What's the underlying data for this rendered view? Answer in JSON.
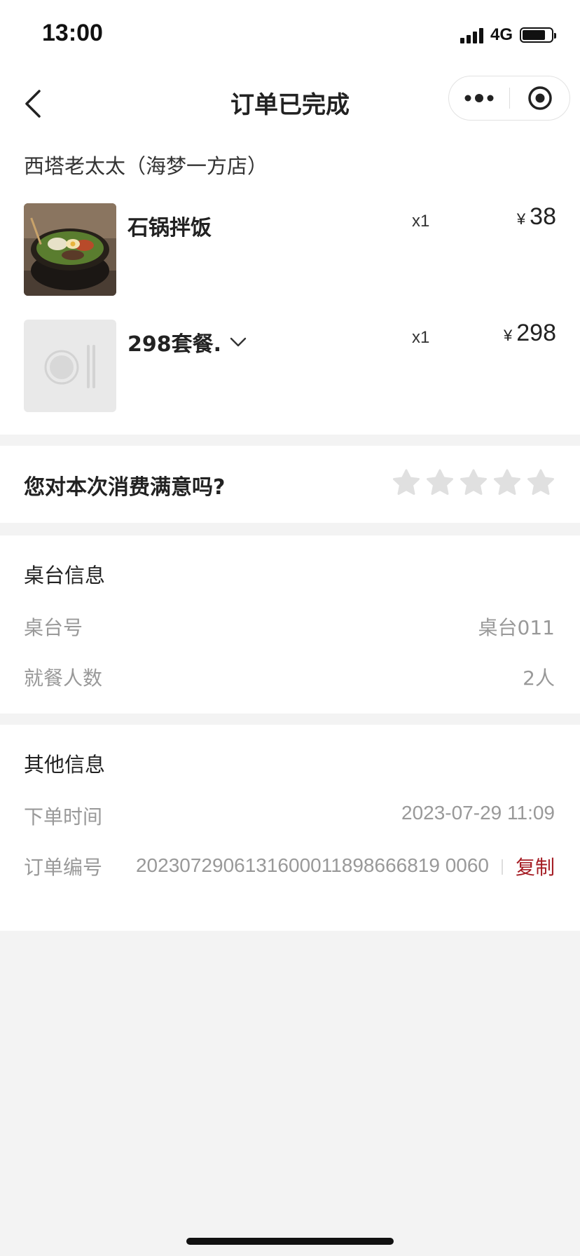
{
  "status": {
    "time": "13:00",
    "network": "4G"
  },
  "nav": {
    "title": "订单已完成"
  },
  "store": {
    "name": "西塔老太太（海梦一方店）"
  },
  "items": [
    {
      "name": "石锅拌饭",
      "qty": "x1",
      "currency": "¥",
      "price": "38"
    },
    {
      "name": "298套餐.",
      "qty": "x1",
      "currency": "¥",
      "price": "298"
    }
  ],
  "rating": {
    "question": "您对本次消费满意吗?",
    "stars": 5,
    "selected": 0
  },
  "table": {
    "title": "桌台信息",
    "rows": [
      {
        "label": "桌台号",
        "value": "桌台011"
      },
      {
        "label": "就餐人数",
        "value": "2人"
      }
    ]
  },
  "other": {
    "title": "其他信息",
    "order_time_label": "下单时间",
    "order_time": "2023-07-29 11:09",
    "order_no_label": "订单编号",
    "order_no": "2023072906131600011898666819 0060",
    "copy_label": "复制"
  },
  "colors": {
    "accent": "#a51d24",
    "muted": "#999999",
    "background": "#f3f3f3"
  }
}
